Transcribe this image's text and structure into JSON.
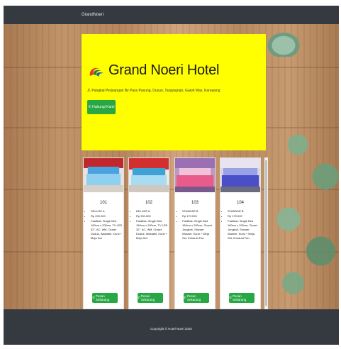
{
  "navbar": {
    "brand": "GrandNoeri"
  },
  "hero": {
    "title": "Grand Noeri Hotel",
    "address": "Jl. Pangkal Perjuangan By Pass Pasung, Dusun, Tanjungrejo, Galuh Mas, Karawang",
    "contact_button": "Hubungi Kami"
  },
  "rooms": [
    {
      "number": "101",
      "features": [
        "DELUXE A",
        "Rp 200.000",
        "Fasilitas: Single Bed 160cm x 200cm, TV LED 32\", AC, Wifi, Closet Duduk, Wastafel, Kursi + Meja Set"
      ],
      "button": "Pesan Sekarang"
    },
    {
      "number": "102",
      "features": [
        "DELUXE A",
        "Rp 200.000",
        "Fasilitas: Single Bed 160cm x 200cm, TV LED 32\", AC, Wifi, Closet Duduk, Wastafel, Kursi + Meja Set"
      ],
      "button": "Pesan Sekarang"
    },
    {
      "number": "103",
      "features": [
        "STANDAR B",
        "Rp 170.000",
        "Fasilitas: Single Bed 160cm x 200cm, Closet Jongkok, Shower Washer, Kursi + Meja Set, Exhaust Fan"
      ],
      "button": "Pesan Sekarang"
    },
    {
      "number": "104",
      "features": [
        "STANDAR B",
        "Rp 170.000",
        "Fasilitas: Single Bed 160cm x 200cm, Closet Jongkok, Shower Washer, Kursi + Meja Set, Exhaust Fan"
      ],
      "button": "Pesan Sekarang"
    }
  ],
  "footer": {
    "copyright": "Copyright © Hotel Noeri 2020"
  },
  "colors": {
    "hero_bg": "#ffff00",
    "button": "#28a745",
    "navbar": "#343a40"
  },
  "icons": {
    "logo": "hotel-logo-swirl",
    "contact": "whatsapp-icon",
    "order": "whatsapp-icon"
  }
}
